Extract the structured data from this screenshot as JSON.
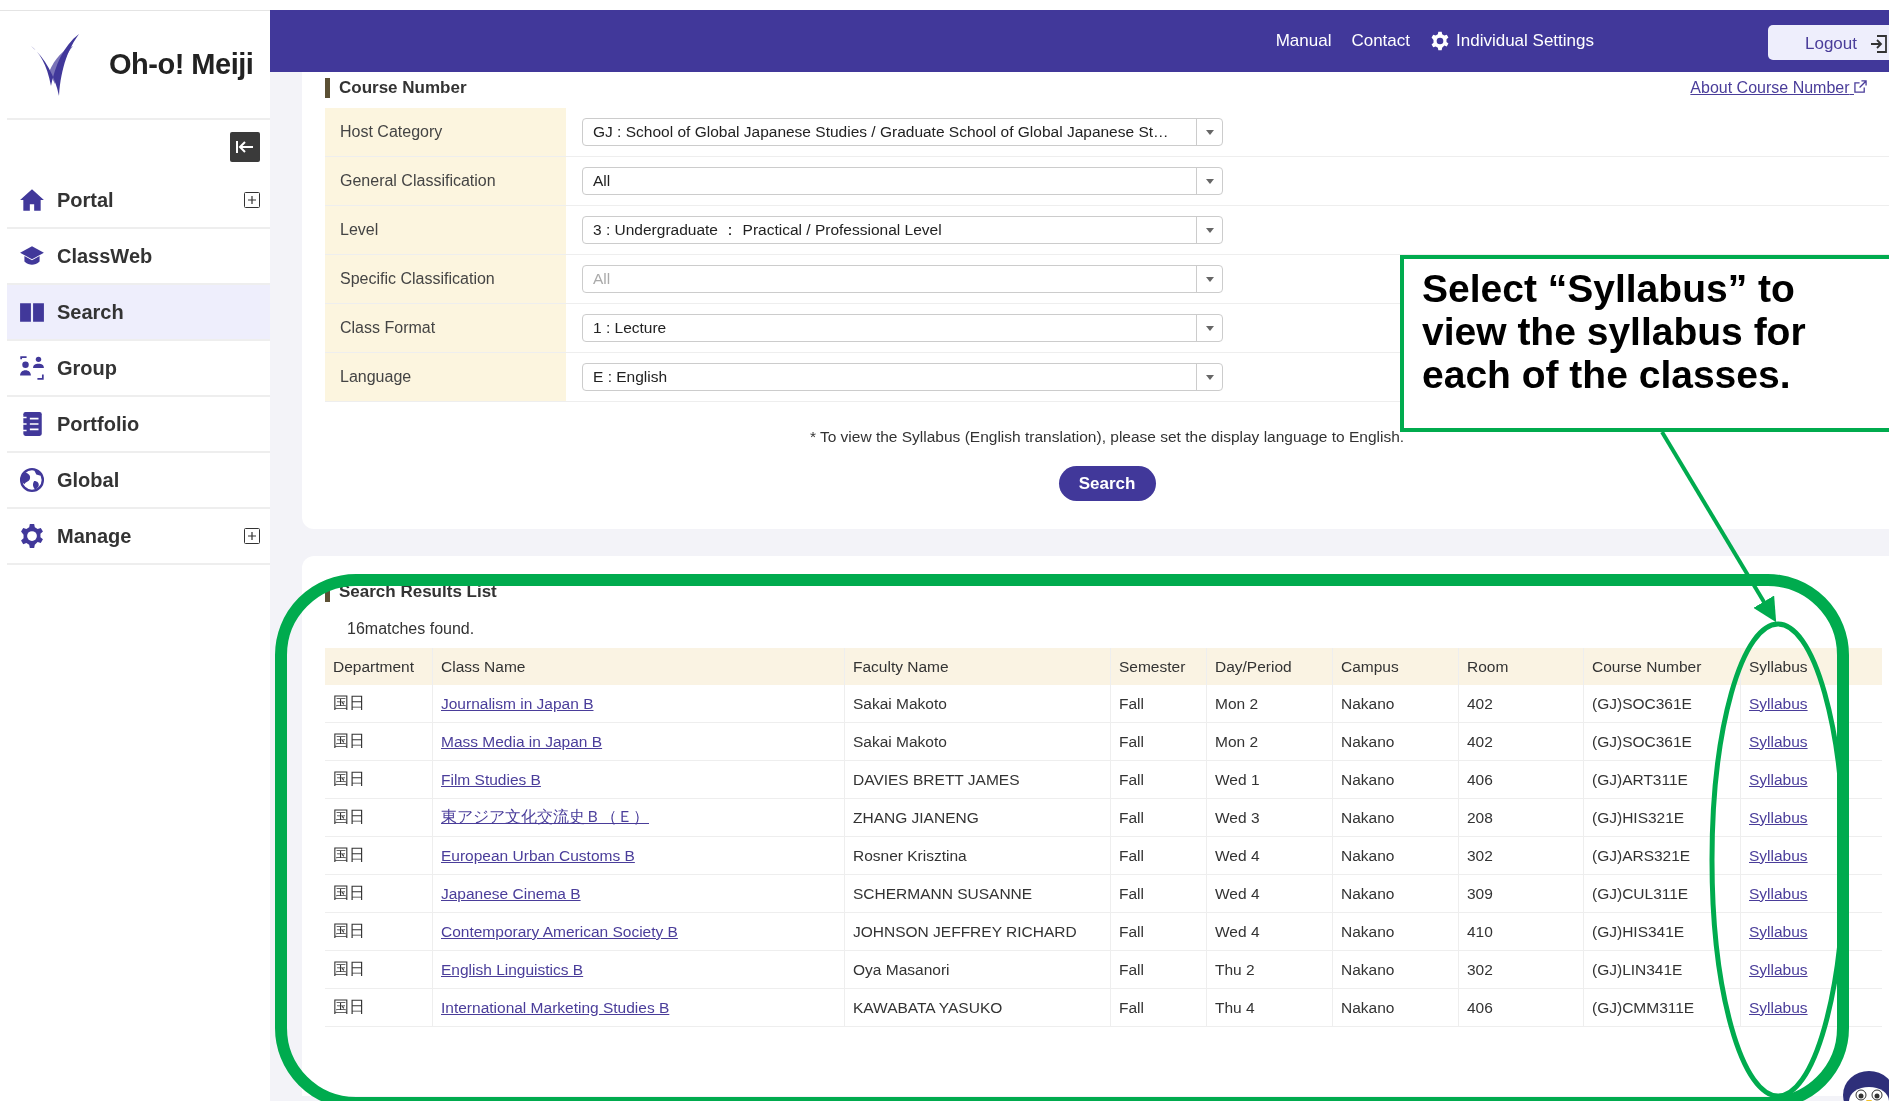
{
  "sidebar": {
    "logo": "Oh-o! Meiji",
    "items": [
      {
        "label": "Portal",
        "selected": false,
        "expandable": true
      },
      {
        "label": "ClassWeb",
        "selected": false,
        "expandable": false
      },
      {
        "label": "Search",
        "selected": true,
        "expandable": false
      },
      {
        "label": "Group",
        "selected": false,
        "expandable": false
      },
      {
        "label": "Portfolio",
        "selected": false,
        "expandable": false
      },
      {
        "label": "Global",
        "selected": false,
        "expandable": false
      },
      {
        "label": "Manage",
        "selected": false,
        "expandable": true
      }
    ]
  },
  "header": {
    "links": [
      "Manual",
      "Contact"
    ],
    "settings": "Individual Settings",
    "logout": "Logout"
  },
  "course_number": {
    "title": "Course Number",
    "help_link": "About Course Number",
    "fields": [
      {
        "label": "Host Category",
        "value": "GJ : School of Global Japanese Studies / Graduate School of Global Japanese St…",
        "disabled": false
      },
      {
        "label": "General Classification",
        "value": "All",
        "disabled": false
      },
      {
        "label": "Level",
        "value": "3 : Undergraduate ： Practical / Professional Level",
        "disabled": false
      },
      {
        "label": "Specific Classification",
        "value": "All",
        "disabled": true
      },
      {
        "label": "Class Format",
        "value": "1 : Lecture",
        "disabled": false
      },
      {
        "label": "Language",
        "value": "E : English",
        "disabled": false
      }
    ],
    "note": "* To view the Syllabus (English translation), please set the display language to English.",
    "search_button": "Search"
  },
  "results": {
    "title": "Search Results List",
    "count": "16matches found.",
    "columns": [
      {
        "label": "Department",
        "kind": "text"
      },
      {
        "label": "Class Name",
        "kind": "link"
      },
      {
        "label": "Faculty Name",
        "kind": "text"
      },
      {
        "label": "Semester",
        "kind": "text"
      },
      {
        "label": "Day/Period",
        "kind": "text"
      },
      {
        "label": "Campus",
        "kind": "text"
      },
      {
        "label": "Room",
        "kind": "text"
      },
      {
        "label": "Course Number",
        "kind": "text"
      },
      {
        "label": "Syllabus",
        "kind": "link"
      }
    ],
    "rows": [
      [
        "国日",
        "Journalism in Japan B",
        "Sakai Makoto",
        "Fall",
        "Mon 2",
        "Nakano",
        "402",
        "(GJ)SOC361E",
        "Syllabus"
      ],
      [
        "国日",
        "Mass Media in Japan B",
        "Sakai Makoto",
        "Fall",
        "Mon 2",
        "Nakano",
        "402",
        "(GJ)SOC361E",
        "Syllabus"
      ],
      [
        "国日",
        "Film Studies B",
        "DAVIES BRETT JAMES",
        "Fall",
        "Wed 1",
        "Nakano",
        "406",
        "(GJ)ART311E",
        "Syllabus"
      ],
      [
        "国日",
        "東アジア文化交流史Ｂ（Ｅ）",
        "ZHANG JIANENG",
        "Fall",
        "Wed 3",
        "Nakano",
        "208",
        "(GJ)HIS321E",
        "Syllabus"
      ],
      [
        "国日",
        "European Urban Customs B",
        "Rosner Krisztina",
        "Fall",
        "Wed 4",
        "Nakano",
        "302",
        "(GJ)ARS321E",
        "Syllabus"
      ],
      [
        "国日",
        "Japanese Cinema B",
        "SCHERMANN SUSANNE",
        "Fall",
        "Wed 4",
        "Nakano",
        "309",
        "(GJ)CUL311E",
        "Syllabus"
      ],
      [
        "国日",
        "Contemporary American Society B",
        "JOHNSON JEFFREY RICHARD",
        "Fall",
        "Wed 4",
        "Nakano",
        "410",
        "(GJ)HIS341E",
        "Syllabus"
      ],
      [
        "国日",
        "English Linguistics B",
        "Oya Masanori",
        "Fall",
        "Thu 2",
        "Nakano",
        "302",
        "(GJ)LIN341E",
        "Syllabus"
      ],
      [
        "国日",
        "International Marketing Studies B",
        "KAWABATA YASUKO",
        "Fall",
        "Thu 4",
        "Nakano",
        "406",
        "(GJ)CMM311E",
        "Syllabus"
      ]
    ]
  },
  "annotation": {
    "text": "Select “Syllabus” to view the syllabus for each of the classes."
  }
}
